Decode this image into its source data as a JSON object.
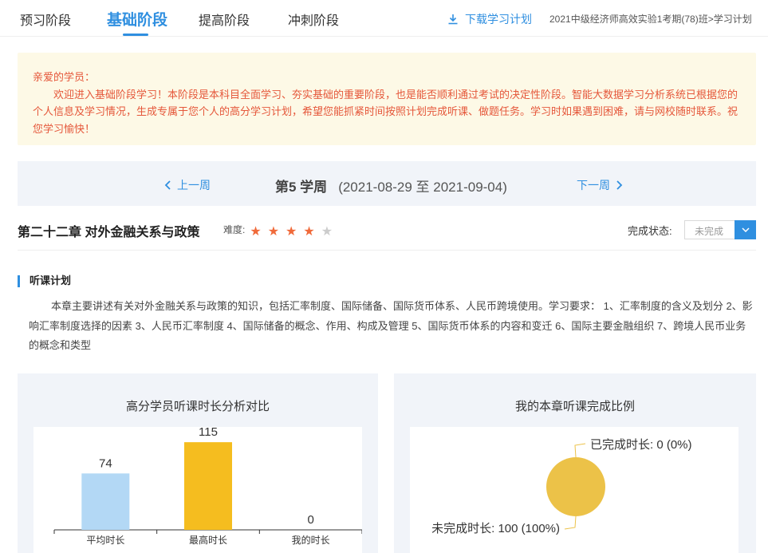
{
  "tabs": [
    {
      "label": "预习阶段",
      "active": false
    },
    {
      "label": "基础阶段",
      "active": true
    },
    {
      "label": "提高阶段",
      "active": false
    },
    {
      "label": "冲刺阶段",
      "active": false
    }
  ],
  "header": {
    "download_label": "下载学习计划",
    "breadcrumb": "2021中级经济师高效实验1考期(78)班>学习计划"
  },
  "notice": {
    "greeting": "亲爱的学员：",
    "body": "欢迎进入基础阶段学习！本阶段是本科目全面学习、夯实基础的重要阶段，也是能否顺利通过考试的决定性阶段。智能大数据学习分析系统已根据您的个人信息及学习情况，生成专属于您个人的高分学习计划，希望您能抓紧时间按照计划完成听课、做题任务。学习时如果遇到困难，请与网校随时联系。祝您学习愉快！"
  },
  "week": {
    "prev_label": "上一周",
    "next_label": "下一周",
    "title": "第5 学周",
    "range": "(2021-08-29 至 2021-09-04)"
  },
  "chapter": {
    "title": "第二十二章 对外金融关系与政策",
    "difficulty_label": "难度:",
    "difficulty_rating": 4,
    "difficulty_max": 5,
    "status_label": "完成状态:",
    "status_value": "未完成"
  },
  "lecture_plan": {
    "title": "听课计划",
    "description": "本章主要讲述有关对外金融关系与政策的知识，包括汇率制度、国际储备、国际货币体系、人民币跨境使用。学习要求： 1、汇率制度的含义及划分 2、影响汇率制度选择的因素 3、人民币汇率制度 4、国际储备的概念、作用、构成及管理 5、国际货币体系的内容和变迁 6、国际主要金融组织 7、跨境人民币业务的概念和类型"
  },
  "colors": {
    "accent": "#2f8fe0",
    "bar_average": "#b3d8f5",
    "bar_highest": "#f5bd1f",
    "pie_incomplete": "#ecc248",
    "notice_text": "#e5573a"
  },
  "chart_data": [
    {
      "type": "bar",
      "title": "高分学员听课时长分析对比",
      "categories": [
        "平均时长",
        "最高时长",
        "我的时长"
      ],
      "values": [
        74,
        115,
        0
      ],
      "ylim": [
        0,
        130
      ],
      "grid": false
    },
    {
      "type": "pie",
      "title": "我的本章听课完成比例",
      "slices": [
        {
          "label": "已完成时长",
          "value": 0,
          "percent": 0,
          "display": "已完成时长: 0 (0%)"
        },
        {
          "label": "未完成时长",
          "value": 100,
          "percent": 100,
          "display": "未完成时长: 100 (100%)"
        }
      ]
    }
  ]
}
